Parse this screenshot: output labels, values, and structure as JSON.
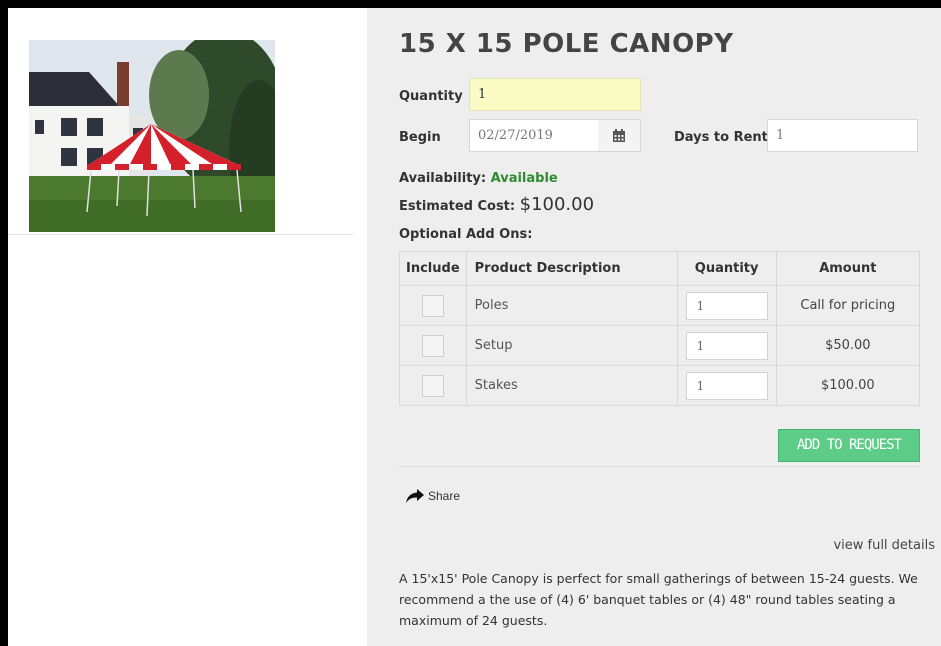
{
  "product": {
    "title": "15 X 15 POLE CANOPY",
    "image_icon": "canopy-tent-photo"
  },
  "form": {
    "quantity_label": "Quantity",
    "quantity_value": "1",
    "begin_label": "Begin",
    "begin_value": "02/27/2019",
    "calendar_icon": "calendar-icon",
    "days_label": "Days to Rent",
    "days_value": "1"
  },
  "availability": {
    "label": "Availability:",
    "value": "Available",
    "color": "#2e8b2e"
  },
  "cost": {
    "label": "Estimated Cost:",
    "value": "$100.00"
  },
  "addons": {
    "heading": "Optional Add Ons:",
    "columns": [
      "Include",
      "Product Description",
      "Quantity",
      "Amount"
    ],
    "rows": [
      {
        "description": "Poles",
        "quantity": "1",
        "amount": "Call for pricing"
      },
      {
        "description": "Setup",
        "quantity": "1",
        "amount": "$50.00"
      },
      {
        "description": "Stakes",
        "quantity": "1",
        "amount": "$100.00"
      }
    ]
  },
  "actions": {
    "add_label": "ADD TO REQUEST",
    "add_color": "#5ccc86",
    "share_label": "Share",
    "share_icon": "share-arrow-icon",
    "view_details": "view full details"
  },
  "description": "A 15'x15' Pole Canopy is perfect for small gatherings of between 15-24 guests.  We recommend a the use of (4) 6' banquet tables or (4) 48\" round tables seating a maximum of 24 guests."
}
